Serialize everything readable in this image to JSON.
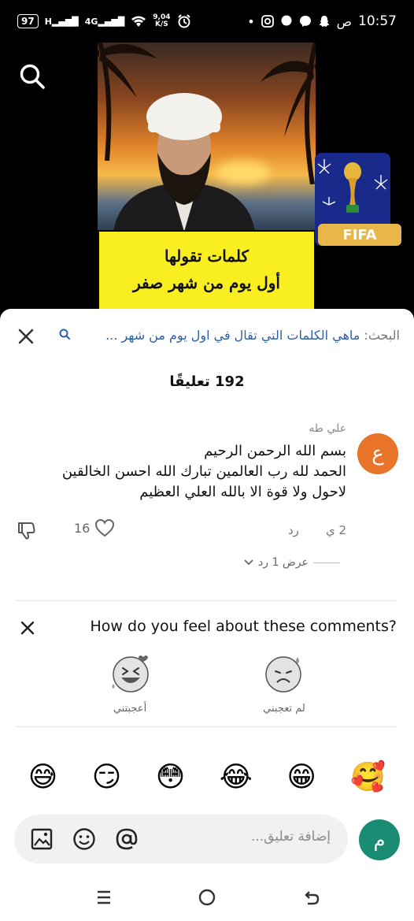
{
  "status_bar": {
    "battery": "97",
    "network_h": "H",
    "network_4g": "4G",
    "speed_value": "9,04",
    "speed_unit": "K/S",
    "ampm": "ص",
    "time": "10:57"
  },
  "video": {
    "overlay_line1": "كلمات تقولها",
    "overlay_line2": "أول يوم من شهر صفر",
    "fifa_label": "FIFA"
  },
  "search_bar": {
    "prefix": "البحث:",
    "query": "ماهي الكلمات التي تقال في اول يوم من شهر ..."
  },
  "comments_count_text": "192 تعليقًا",
  "comment": {
    "avatar_letter": "ع",
    "author": "علي طه",
    "lines": [
      "بسم الله الرحمن الرحيم",
      "الحمد لله رب العالمين تبارك الله احسن الخالقين",
      "لاحول ولا قوة الا بالله العلي العظيم"
    ],
    "time": "2 ي",
    "reply_label": "رد",
    "likes": "16",
    "view_replies": "عرض 1 رد"
  },
  "feedback": {
    "question": "How do you feel about these comments?",
    "options": [
      {
        "label": "لم تعجبني",
        "icon": "sad-face-icon"
      },
      {
        "label": "أعجبتني",
        "icon": "laughing-face-icon"
      }
    ]
  },
  "quick_emojis": [
    "😅",
    "😏",
    "😳",
    "😂",
    "😁",
    "🥰"
  ],
  "input": {
    "placeholder": "إضافة تعليق...",
    "user_avatar_letter": "م"
  },
  "colors": {
    "comment_avatar": "#e8742a",
    "user_avatar": "#1a8c73",
    "search_link": "#2b5fa8",
    "overlay_yellow": "#f9ef20"
  }
}
